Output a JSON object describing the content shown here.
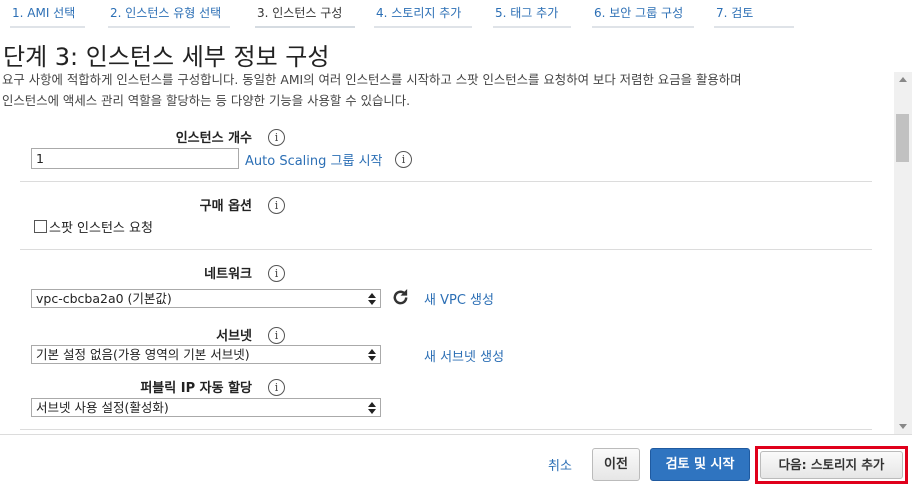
{
  "tabs": [
    {
      "label": "1. AMI 선택"
    },
    {
      "label": "2. 인스턴스 유형 선택"
    },
    {
      "label": "3. 인스턴스 구성"
    },
    {
      "label": "4. 스토리지 추가"
    },
    {
      "label": "5. 태그 추가"
    },
    {
      "label": "6. 보안 그룹 구성"
    },
    {
      "label": "7. 검토"
    }
  ],
  "page": {
    "title": "단계 3: 인스턴스 세부 정보 구성",
    "desc_line1": "요구 사항에 적합하게 인스턴스를 구성합니다. 동일한 AMI의 여러 인스턴스를 시작하고 스팟 인스턴스를 요청하여 보다 저렴한 요금을 활용하며",
    "desc_line2": "인스턴스에 액세스 관리 역할을 할당하는 등 다양한 기능을 사용할 수 있습니다."
  },
  "form": {
    "instance_count": {
      "label": "인스턴스 개수",
      "value": "1",
      "link": "Auto Scaling 그룹 시작"
    },
    "purchase": {
      "label": "구매 옵션",
      "checkbox_label": "스팟 인스턴스 요청"
    },
    "network": {
      "label": "네트워크",
      "value": "vpc-cbcba2a0 (기본값)",
      "link": "새 VPC 생성"
    },
    "subnet": {
      "label": "서브넷",
      "value": "기본 설정 없음(가용 영역의 기본 서브넷)",
      "link": "새 서브넷 생성"
    },
    "public_ip": {
      "label": "퍼블릭 IP 자동 할당",
      "value": "서브넷 사용 설정(활성화)"
    },
    "info_glyph": "i"
  },
  "footer": {
    "cancel": "취소",
    "previous": "이전",
    "review_launch": "검토 및 시작",
    "next": "다음: 스토리지 추가"
  },
  "colors": {
    "link": "#2c6fb5",
    "primary_button": "#2f74c0",
    "highlight_outline": "#e0001b"
  }
}
